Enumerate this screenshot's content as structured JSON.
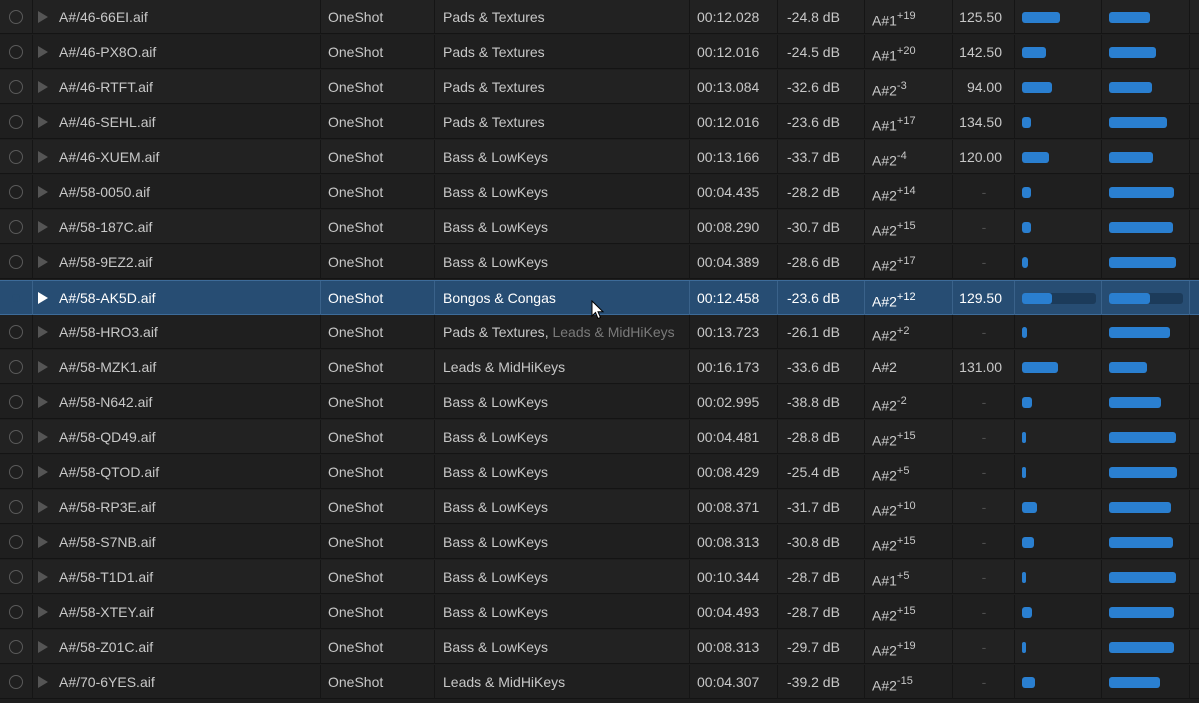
{
  "colors": {
    "background": "#1e1e1e",
    "selected_row": "#274d73",
    "bar": "#2a7fd0"
  },
  "rows": [
    {
      "name": "A#/46-66EI.aif",
      "type": "OneShot",
      "category": "Pads & Textures",
      "category2": "",
      "duration": "00:12.028",
      "level": "-24.8 dB",
      "key": "A#1",
      "key_offset": "+19",
      "bpm": "125.50",
      "meter1": 0.52,
      "meter2": 0.55,
      "selected": false
    },
    {
      "name": "A#/46-PX8O.aif",
      "type": "OneShot",
      "category": "Pads & Textures",
      "category2": "",
      "duration": "00:12.016",
      "level": "-24.5 dB",
      "key": "A#1",
      "key_offset": "+20",
      "bpm": "142.50",
      "meter1": 0.33,
      "meter2": 0.64,
      "selected": false
    },
    {
      "name": "A#/46-RTFT.aif",
      "type": "OneShot",
      "category": "Pads & Textures",
      "category2": "",
      "duration": "00:13.084",
      "level": "-32.6 dB",
      "key": "A#2",
      "key_offset": "-3",
      "bpm": "94.00",
      "meter1": 0.4,
      "meter2": 0.58,
      "selected": false
    },
    {
      "name": "A#/46-SEHL.aif",
      "type": "OneShot",
      "category": "Pads & Textures",
      "category2": "",
      "duration": "00:12.016",
      "level": "-23.6 dB",
      "key": "A#1",
      "key_offset": "+17",
      "bpm": "134.50",
      "meter1": 0.12,
      "meter2": 0.78,
      "selected": false
    },
    {
      "name": "A#/46-XUEM.aif",
      "type": "OneShot",
      "category": "Bass & LowKeys",
      "category2": "",
      "duration": "00:13.166",
      "level": "-33.7 dB",
      "key": "A#2",
      "key_offset": "-4",
      "bpm": "120.00",
      "meter1": 0.36,
      "meter2": 0.6,
      "selected": false
    },
    {
      "name": "A#/58-0050.aif",
      "type": "OneShot",
      "category": "Bass & LowKeys",
      "category2": "",
      "duration": "00:04.435",
      "level": "-28.2 dB",
      "key": "A#2",
      "key_offset": "+14",
      "bpm": "-",
      "meter1": 0.12,
      "meter2": 0.88,
      "selected": false
    },
    {
      "name": "A#/58-187C.aif",
      "type": "OneShot",
      "category": "Bass & LowKeys",
      "category2": "",
      "duration": "00:08.290",
      "level": "-30.7 dB",
      "key": "A#2",
      "key_offset": "+15",
      "bpm": "-",
      "meter1": 0.12,
      "meter2": 0.86,
      "selected": false
    },
    {
      "name": "A#/58-9EZ2.aif",
      "type": "OneShot",
      "category": "Bass & LowKeys",
      "category2": "",
      "duration": "00:04.389",
      "level": "-28.6 dB",
      "key": "A#2",
      "key_offset": "+17",
      "bpm": "-",
      "meter1": 0.08,
      "meter2": 0.9,
      "selected": false
    },
    {
      "name": "A#/58-AK5D.aif",
      "type": "OneShot",
      "category": "Bongos & Congas",
      "category2": "",
      "duration": "00:12.458",
      "level": "-23.6 dB",
      "key": "A#2",
      "key_offset": "+12",
      "bpm": "129.50",
      "meter1": 0.4,
      "meter2": 0.55,
      "selected": true
    },
    {
      "name": "A#/58-HRO3.aif",
      "type": "OneShot",
      "category": "Pads & Textures",
      "category2": "Leads & MidHiKeys",
      "duration": "00:13.723",
      "level": "-26.1 dB",
      "key": "A#2",
      "key_offset": "+2",
      "bpm": "-",
      "meter1": 0.07,
      "meter2": 0.82,
      "selected": false
    },
    {
      "name": "A#/58-MZK1.aif",
      "type": "OneShot",
      "category": "Leads & MidHiKeys",
      "category2": "",
      "duration": "00:16.173",
      "level": "-33.6 dB",
      "key": "A#2",
      "key_offset": "",
      "bpm": "131.00",
      "meter1": 0.49,
      "meter2": 0.52,
      "selected": false
    },
    {
      "name": "A#/58-N642.aif",
      "type": "OneShot",
      "category": "Bass & LowKeys",
      "category2": "",
      "duration": "00:02.995",
      "level": "-38.8 dB",
      "key": "A#2",
      "key_offset": "-2",
      "bpm": "-",
      "meter1": 0.14,
      "meter2": 0.7,
      "selected": false
    },
    {
      "name": "A#/58-QD49.aif",
      "type": "OneShot",
      "category": "Bass & LowKeys",
      "category2": "",
      "duration": "00:04.481",
      "level": "-28.8 dB",
      "key": "A#2",
      "key_offset": "+15",
      "bpm": "-",
      "meter1": 0.03,
      "meter2": 0.9,
      "selected": false
    },
    {
      "name": "A#/58-QTOD.aif",
      "type": "OneShot",
      "category": "Bass & LowKeys",
      "category2": "",
      "duration": "00:08.429",
      "level": "-25.4 dB",
      "key": "A#2",
      "key_offset": "+5",
      "bpm": "-",
      "meter1": 0.03,
      "meter2": 0.92,
      "selected": false
    },
    {
      "name": "A#/58-RP3E.aif",
      "type": "OneShot",
      "category": "Bass & LowKeys",
      "category2": "",
      "duration": "00:08.371",
      "level": "-31.7 dB",
      "key": "A#2",
      "key_offset": "+10",
      "bpm": "-",
      "meter1": 0.2,
      "meter2": 0.84,
      "selected": false
    },
    {
      "name": "A#/58-S7NB.aif",
      "type": "OneShot",
      "category": "Bass & LowKeys",
      "category2": "",
      "duration": "00:08.313",
      "level": "-30.8 dB",
      "key": "A#2",
      "key_offset": "+15",
      "bpm": "-",
      "meter1": 0.16,
      "meter2": 0.86,
      "selected": false
    },
    {
      "name": "A#/58-T1D1.aif",
      "type": "OneShot",
      "category": "Bass & LowKeys",
      "category2": "",
      "duration": "00:10.344",
      "level": "-28.7 dB",
      "key": "A#1",
      "key_offset": "+5",
      "bpm": "-",
      "meter1": 0.03,
      "meter2": 0.91,
      "selected": false
    },
    {
      "name": "A#/58-XTEY.aif",
      "type": "OneShot",
      "category": "Bass & LowKeys",
      "category2": "",
      "duration": "00:04.493",
      "level": "-28.7 dB",
      "key": "A#2",
      "key_offset": "+15",
      "bpm": "-",
      "meter1": 0.14,
      "meter2": 0.88,
      "selected": false
    },
    {
      "name": "A#/58-Z01C.aif",
      "type": "OneShot",
      "category": "Bass & LowKeys",
      "category2": "",
      "duration": "00:08.313",
      "level": "-29.7 dB",
      "key": "A#2",
      "key_offset": "+19",
      "bpm": "-",
      "meter1": 0.03,
      "meter2": 0.88,
      "selected": false
    },
    {
      "name": "A#/70-6YES.aif",
      "type": "OneShot",
      "category": "Leads & MidHiKeys",
      "category2": "",
      "duration": "00:04.307",
      "level": "-39.2 dB",
      "key": "A#2",
      "key_offset": "-15",
      "bpm": "-",
      "meter1": 0.17,
      "meter2": 0.69,
      "selected": false
    }
  ]
}
